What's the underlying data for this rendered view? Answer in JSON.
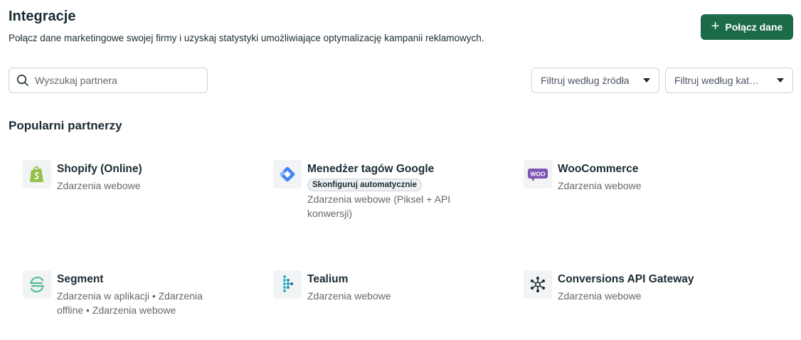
{
  "header": {
    "title": "Integracje",
    "subtitle": "Połącz dane marketingowe swojej firmy i uzyskaj statystyki umożliwiające optymalizację kampanii reklamowych.",
    "connect_label": "Połącz dane"
  },
  "search": {
    "placeholder": "Wyszukaj partnera"
  },
  "filters": {
    "source": "Filtruj według źródła",
    "category": "Filtruj według kategorii"
  },
  "section": {
    "title": "Popularni partnerzy"
  },
  "partners": [
    {
      "name": "Shopify (Online)",
      "desc": "Zdarzenia webowe",
      "icon": "shopify-icon"
    },
    {
      "name": "Menedżer tagów Google",
      "badge": "Skonfiguruj automatycznie",
      "desc": "Zdarzenia webowe (Piksel + API konwersji)",
      "icon": "google-tag-manager-icon"
    },
    {
      "name": "WooCommerce",
      "desc": "Zdarzenia webowe",
      "icon": "woocommerce-icon",
      "logo_text": "WOO"
    },
    {
      "name": "Segment",
      "desc": "Zdarzenia w aplikacji • Zdarzenia offline • Zdarzenia webowe",
      "icon": "segment-icon"
    },
    {
      "name": "Tealium",
      "desc": "Zdarzenia webowe",
      "icon": "tealium-icon"
    },
    {
      "name": "Conversions API Gateway",
      "desc": "Zdarzenia webowe",
      "icon": "conversions-api-gateway-icon"
    }
  ],
  "colors": {
    "primary": "#1b6b48",
    "shopify": "#95bf47",
    "gtm": "#4285f4",
    "woocommerce": "#7f54b3",
    "segment": "#52bd94",
    "tealium": "#2ab5c4"
  }
}
